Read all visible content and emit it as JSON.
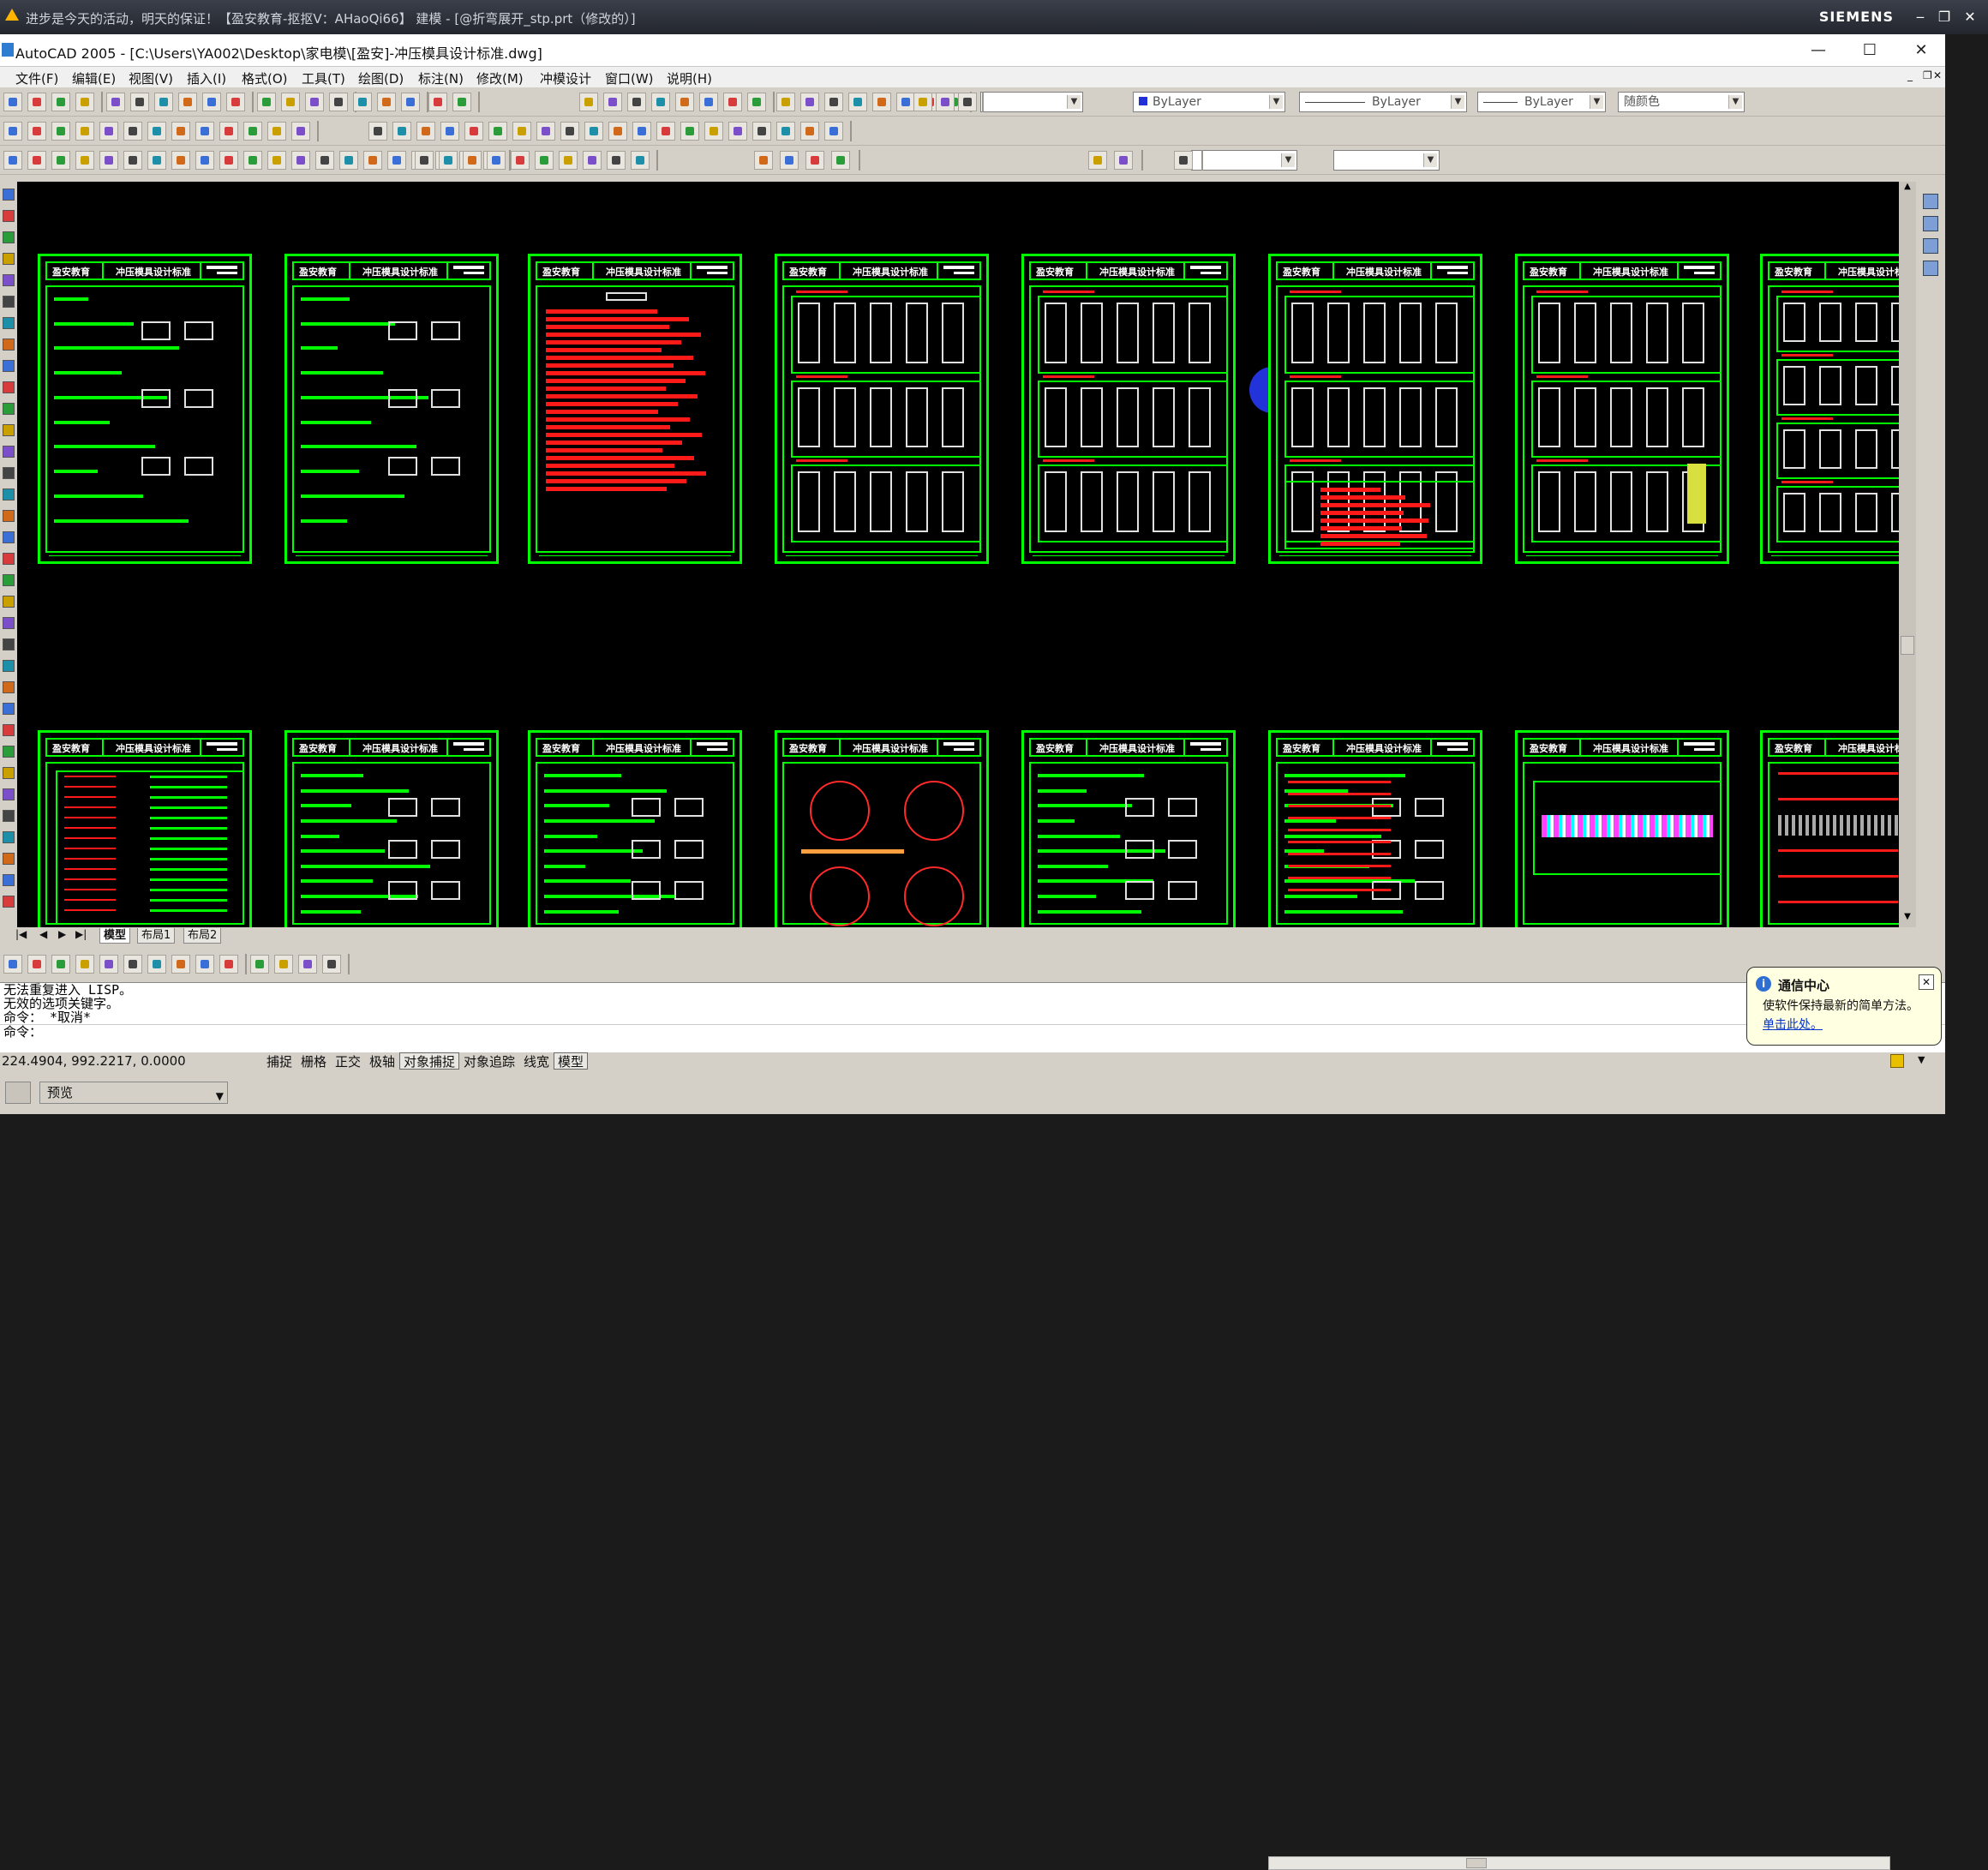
{
  "nx": {
    "title": "进步是今天的活动，明天的保证！【盈安教育-抠抠V：AHaoQi66】  建模 - [@折弯展开_stp.prt（修改的）]",
    "brand": "SIEMENS"
  },
  "window": {
    "title": "AutoCAD 2005 - [C:\\Users\\YA002\\Desktop\\家电模\\[盈安]-冲压模具设计标准.dwg]",
    "minimize": "—",
    "maximize": "☐",
    "close": "✕"
  },
  "menu": [
    "文件(F)",
    "编辑(E)",
    "视图(V)",
    "插入(I)",
    "格式(O)",
    "工具(T)",
    "绘图(D)",
    "标注(N)",
    "修改(M)",
    "冲模设计",
    "窗口(W)",
    "说明(H)"
  ],
  "properties": {
    "layer": "ByLayer",
    "linetype": "ByLayer",
    "lineweight": "ByLayer",
    "plotstyle": "随颜色"
  },
  "sheets": {
    "company": "盈安教育",
    "title": "冲压模具设计标准"
  },
  "layout_tabs": [
    "模型",
    "布局1",
    "布局2"
  ],
  "command": {
    "lines": [
      "无法重复进入 LISP。",
      "无效的选项关键字。",
      "命令： *取消*",
      "命令："
    ]
  },
  "status": {
    "coords": "224.4904, 992.2217, 0.0000",
    "buttons": [
      "捕捉",
      "栅格",
      "正交",
      "极轴",
      "对象捕捉",
      "对象追踪",
      "线宽",
      "模型"
    ]
  },
  "preview": {
    "label": "预览"
  },
  "balloon": {
    "title": "通信中心",
    "text": "使软件保持最新的简单方法。",
    "link": "单击此处。"
  }
}
